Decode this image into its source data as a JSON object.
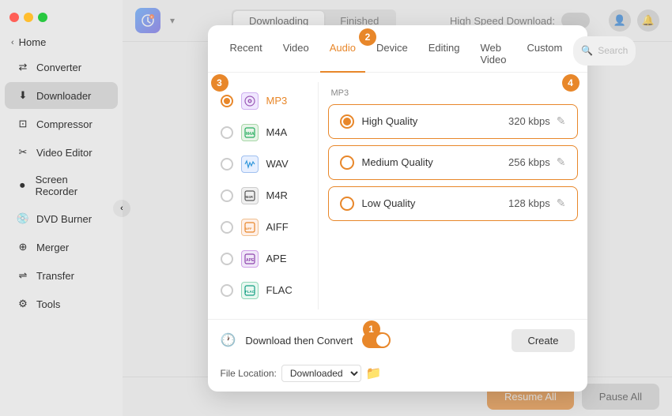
{
  "sidebar": {
    "items": [
      {
        "label": "Home",
        "icon": "🏠",
        "active": false
      },
      {
        "label": "Converter",
        "icon": "⇄",
        "active": false
      },
      {
        "label": "Downloader",
        "icon": "↓",
        "active": true
      },
      {
        "label": "Compressor",
        "icon": "⊡",
        "active": false
      },
      {
        "label": "Video Editor",
        "icon": "✂",
        "active": false
      },
      {
        "label": "Screen Recorder",
        "icon": "⏺",
        "active": false
      },
      {
        "label": "DVD Burner",
        "icon": "💿",
        "active": false
      },
      {
        "label": "Merger",
        "icon": "⊕",
        "active": false
      },
      {
        "label": "Transfer",
        "icon": "⇌",
        "active": false
      },
      {
        "label": "Tools",
        "icon": "⚙",
        "active": false
      }
    ]
  },
  "topbar": {
    "download_tab_active": "Downloading",
    "download_tab_finished": "Finished",
    "high_speed_label": "High Speed Download:",
    "logo_symbol": "✦"
  },
  "modal": {
    "tabs": [
      "Recent",
      "Video",
      "Audio",
      "Device",
      "Editing",
      "Web Video",
      "Custom"
    ],
    "active_tab": "Audio",
    "search_placeholder": "Search",
    "formats": [
      {
        "id": "mp3",
        "label": "MP3",
        "selected": true
      },
      {
        "id": "m4a",
        "label": "M4A",
        "selected": false
      },
      {
        "id": "wav",
        "label": "WAV",
        "selected": false
      },
      {
        "id": "m4r",
        "label": "M4R",
        "selected": false
      },
      {
        "id": "aiff",
        "label": "AIFF",
        "selected": false
      },
      {
        "id": "ape",
        "label": "APE",
        "selected": false
      },
      {
        "id": "flac",
        "label": "FLAC",
        "selected": false
      }
    ],
    "quality_label": "MP3",
    "qualities": [
      {
        "label": "High Quality",
        "bitrate": "320 kbps",
        "selected": true
      },
      {
        "label": "Medium Quality",
        "bitrate": "256 kbps",
        "selected": false
      },
      {
        "label": "Low Quality",
        "bitrate": "128 kbps",
        "selected": false
      }
    ],
    "create_button": "Create"
  },
  "badges": {
    "b1": "1",
    "b2": "2",
    "b3": "3",
    "b4": "4"
  },
  "footer": {
    "download_convert_label": "Download then Convert",
    "file_location_label": "File Location:",
    "file_location_value": "Downloaded",
    "resume_all": "Resume All",
    "pause_all": "Pause All"
  }
}
